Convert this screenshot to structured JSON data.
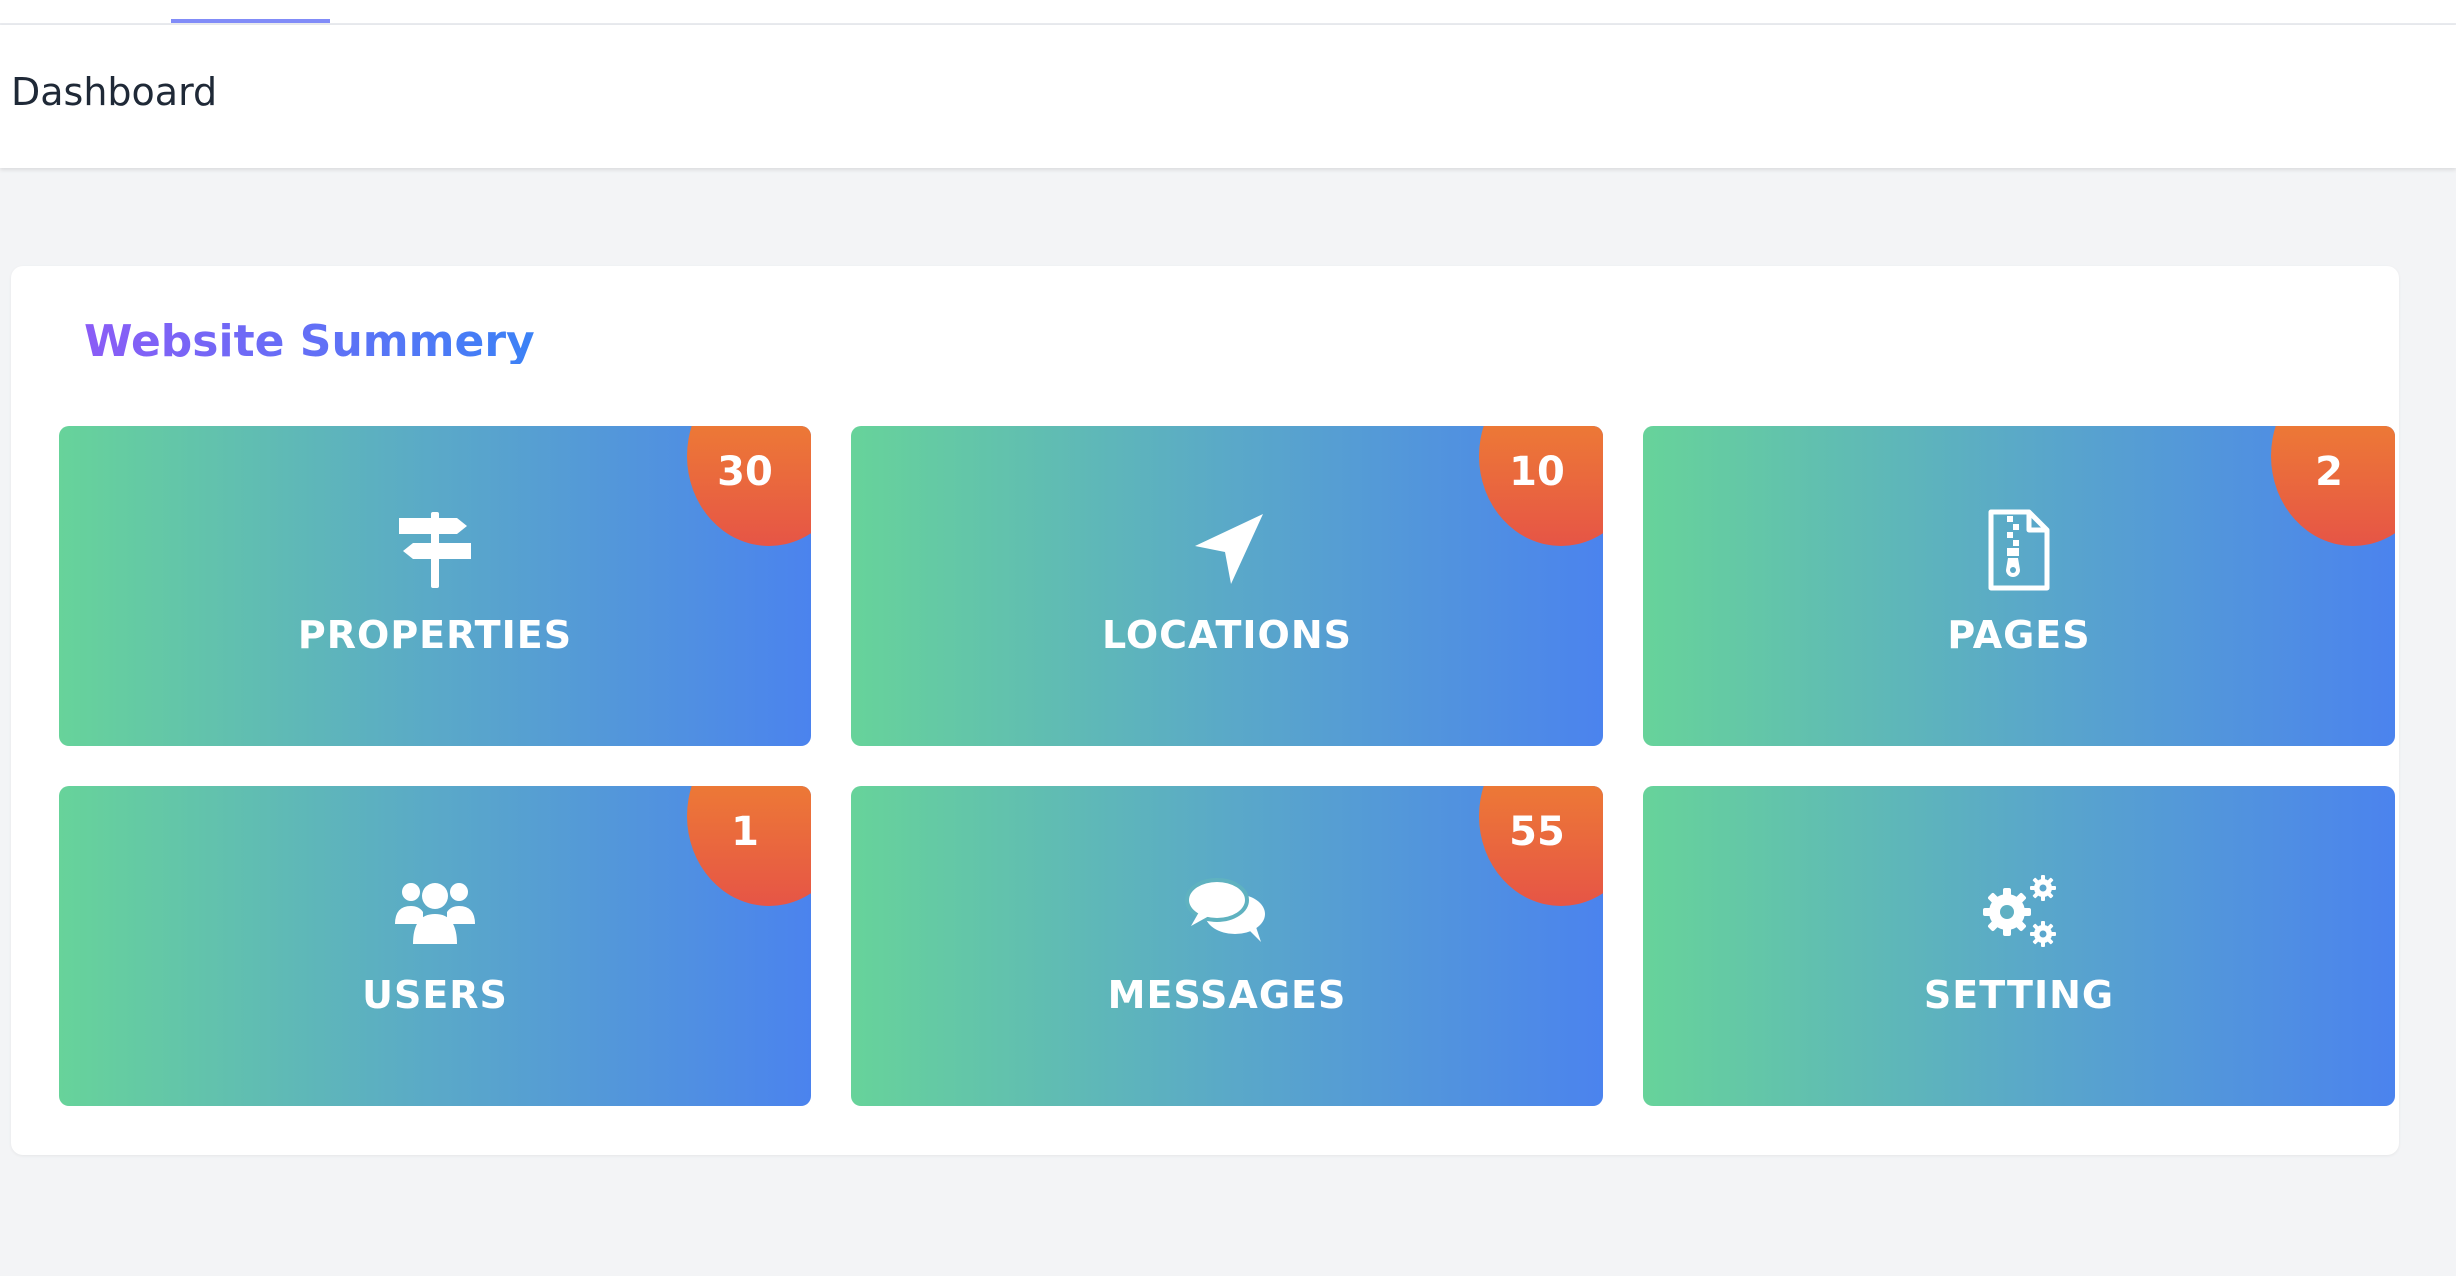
{
  "page_title": "Dashboard",
  "summary": {
    "title": "Website Summery",
    "tiles": [
      {
        "label": "PROPERTIES",
        "count": "30",
        "icon": "signpost-icon"
      },
      {
        "label": "LOCATIONS",
        "count": "10",
        "icon": "location-arrow-icon"
      },
      {
        "label": "PAGES",
        "count": "2",
        "icon": "file-zip-icon"
      },
      {
        "label": "USERS",
        "count": "1",
        "icon": "users-icon"
      },
      {
        "label": "MESSAGES",
        "count": "55",
        "icon": "comments-icon"
      },
      {
        "label": "SETTING",
        "count": "",
        "icon": "cogs-icon"
      }
    ]
  },
  "colors": {
    "tile_gradient_start": "#67d39a",
    "tile_gradient_end": "#4b83ee",
    "badge_gradient_start": "#f08a2e",
    "badge_gradient_end": "#e65546",
    "title_accent": "#6b6cdf"
  }
}
